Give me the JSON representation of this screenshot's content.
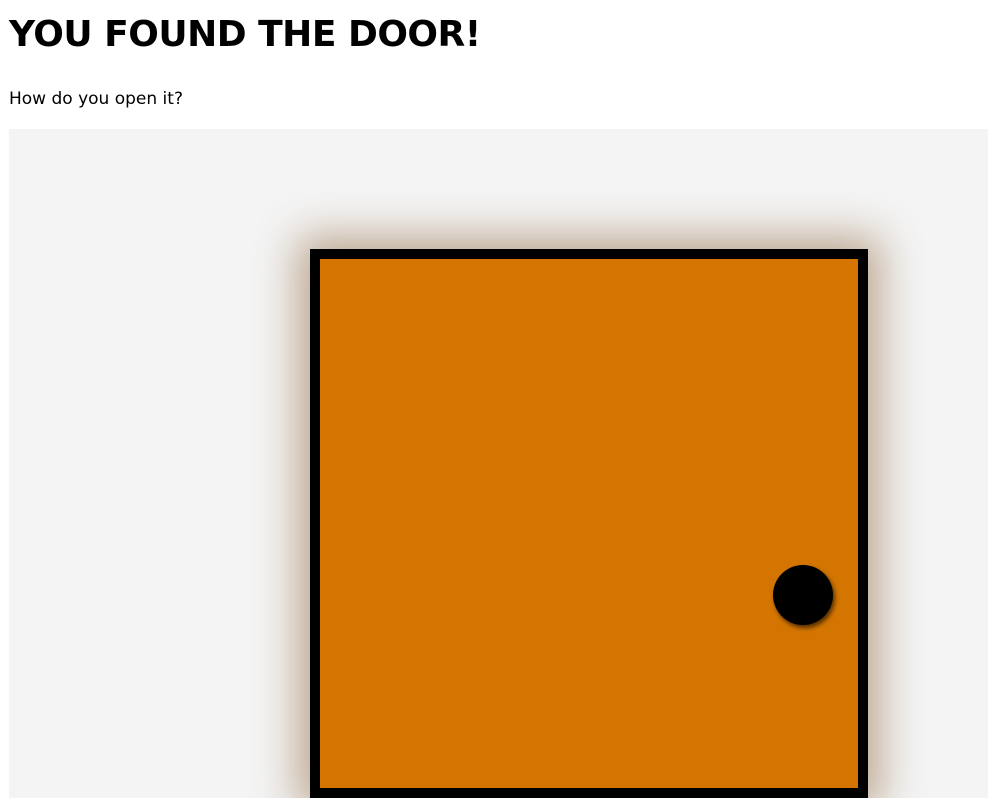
{
  "header": {
    "title": "YOU FOUND THE DOOR!",
    "prompt": "How do you open it?"
  },
  "door": {
    "color": "#d37500",
    "frame_color": "#000000",
    "knob_color": "#000000",
    "background": "#f4f4f4"
  }
}
